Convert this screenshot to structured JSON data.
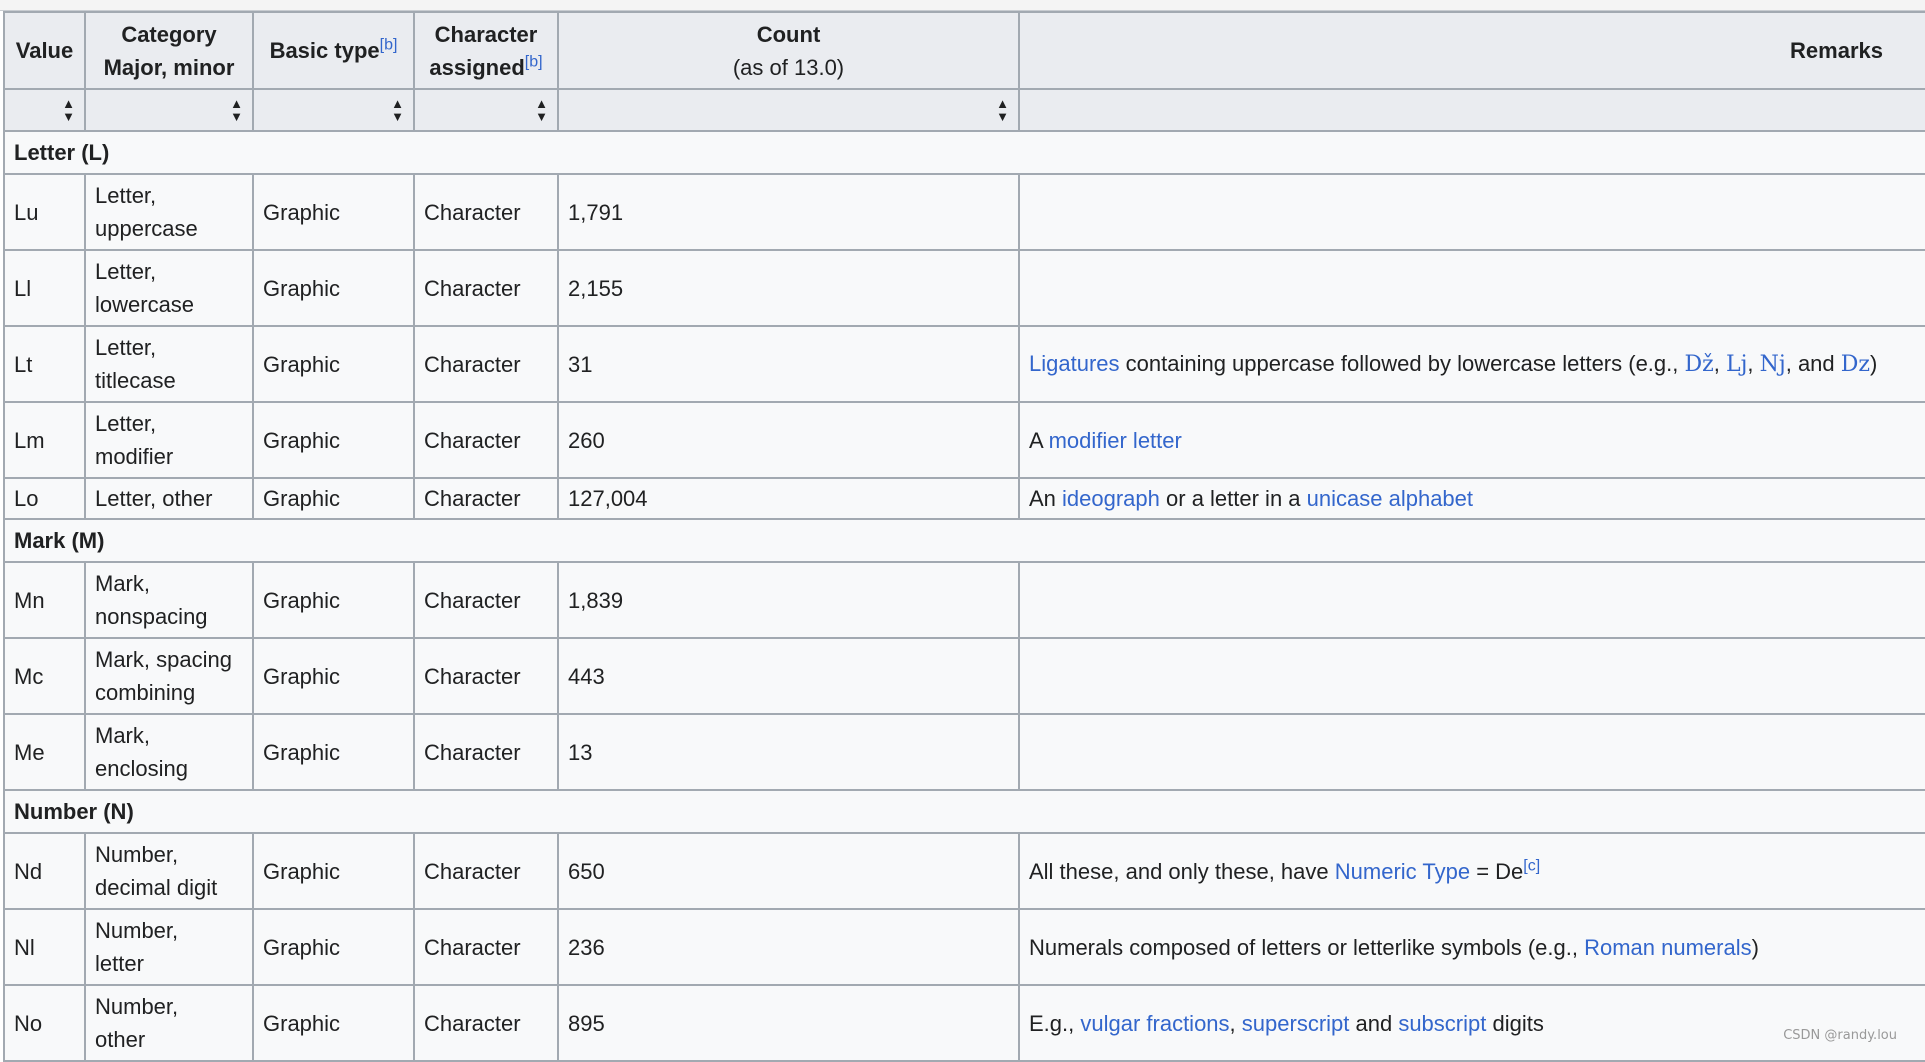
{
  "header": {
    "value": "Value",
    "category_line1": "Category",
    "category_line2": "Major, minor",
    "basic_type": "Basic type",
    "basic_type_ref": "[b]",
    "char_assigned_line1": "Character",
    "char_assigned_line2": "assigned",
    "char_assigned_ref": "[b]",
    "count": "Count",
    "count_sub": "(as of 13.0)",
    "remarks": "Remarks"
  },
  "sections": {
    "letter": "Letter (L)",
    "mark": "Mark (M)",
    "number": "Number (N)"
  },
  "rows": {
    "lu": {
      "value": "Lu",
      "cat1": "Letter,",
      "cat2": "uppercase",
      "type": "Graphic",
      "assigned": "Character",
      "count": "1,791"
    },
    "ll": {
      "value": "Ll",
      "cat1": "Letter,",
      "cat2": "lowercase",
      "type": "Graphic",
      "assigned": "Character",
      "count": "2,155"
    },
    "lt": {
      "value": "Lt",
      "cat1": "Letter,",
      "cat2": "titlecase",
      "type": "Graphic",
      "assigned": "Character",
      "count": "31",
      "r_link": "Ligatures",
      "r_text": " containing uppercase followed by lowercase letters (e.g., ",
      "lig1": "Dž",
      "sep1": ", ",
      "lig2": "Lj",
      "sep2": ", ",
      "lig3": "Nj",
      "sep3": ", and ",
      "lig4": "Dz",
      "end": ")"
    },
    "lm": {
      "value": "Lm",
      "cat1": "Letter,",
      "cat2": "modifier",
      "type": "Graphic",
      "assigned": "Character",
      "count": "260",
      "r_text1": "A ",
      "r_link": "modifier letter"
    },
    "lo": {
      "value": "Lo",
      "cat": "Letter, other",
      "type": "Graphic",
      "assigned": "Character",
      "count": "127,004",
      "r_text1": "An ",
      "r_link1": "ideograph",
      "r_text2": " or a letter in a ",
      "r_link2": "unicase alphabet"
    },
    "mn": {
      "value": "Mn",
      "cat1": "Mark,",
      "cat2": "nonspacing",
      "type": "Graphic",
      "assigned": "Character",
      "count": "1,839"
    },
    "mc": {
      "value": "Mc",
      "cat1": "Mark, spacing",
      "cat2": "combining",
      "type": "Graphic",
      "assigned": "Character",
      "count": "443"
    },
    "me": {
      "value": "Me",
      "cat1": "Mark,",
      "cat2": "enclosing",
      "type": "Graphic",
      "assigned": "Character",
      "count": "13"
    },
    "nd": {
      "value": "Nd",
      "cat1": "Number,",
      "cat2": "decimal digit",
      "type": "Graphic",
      "assigned": "Character",
      "count": "650",
      "r_text1": "All these, and only these, have ",
      "r_link": "Numeric Type",
      "r_text2": " = De",
      "r_ref": "[c]"
    },
    "nl": {
      "value": "Nl",
      "cat1": "Number,",
      "cat2": "letter",
      "type": "Graphic",
      "assigned": "Character",
      "count": "236",
      "r_text1": "Numerals composed of letters or letterlike symbols (e.g., ",
      "r_link": "Roman numerals",
      "r_text2": ")"
    },
    "no": {
      "value": "No",
      "cat1": "Number,",
      "cat2": "other",
      "type": "Graphic",
      "assigned": "Character",
      "count": "895",
      "r_text1": "E.g., ",
      "r_link1": "vulgar fractions",
      "r_text2": ", ",
      "r_link2": "superscript",
      "r_text3": " and ",
      "r_link3": "subscript",
      "r_text4": " digits"
    }
  },
  "sort_icon": "sort-arrows-icon",
  "watermark": "CSDN @randy.lou"
}
